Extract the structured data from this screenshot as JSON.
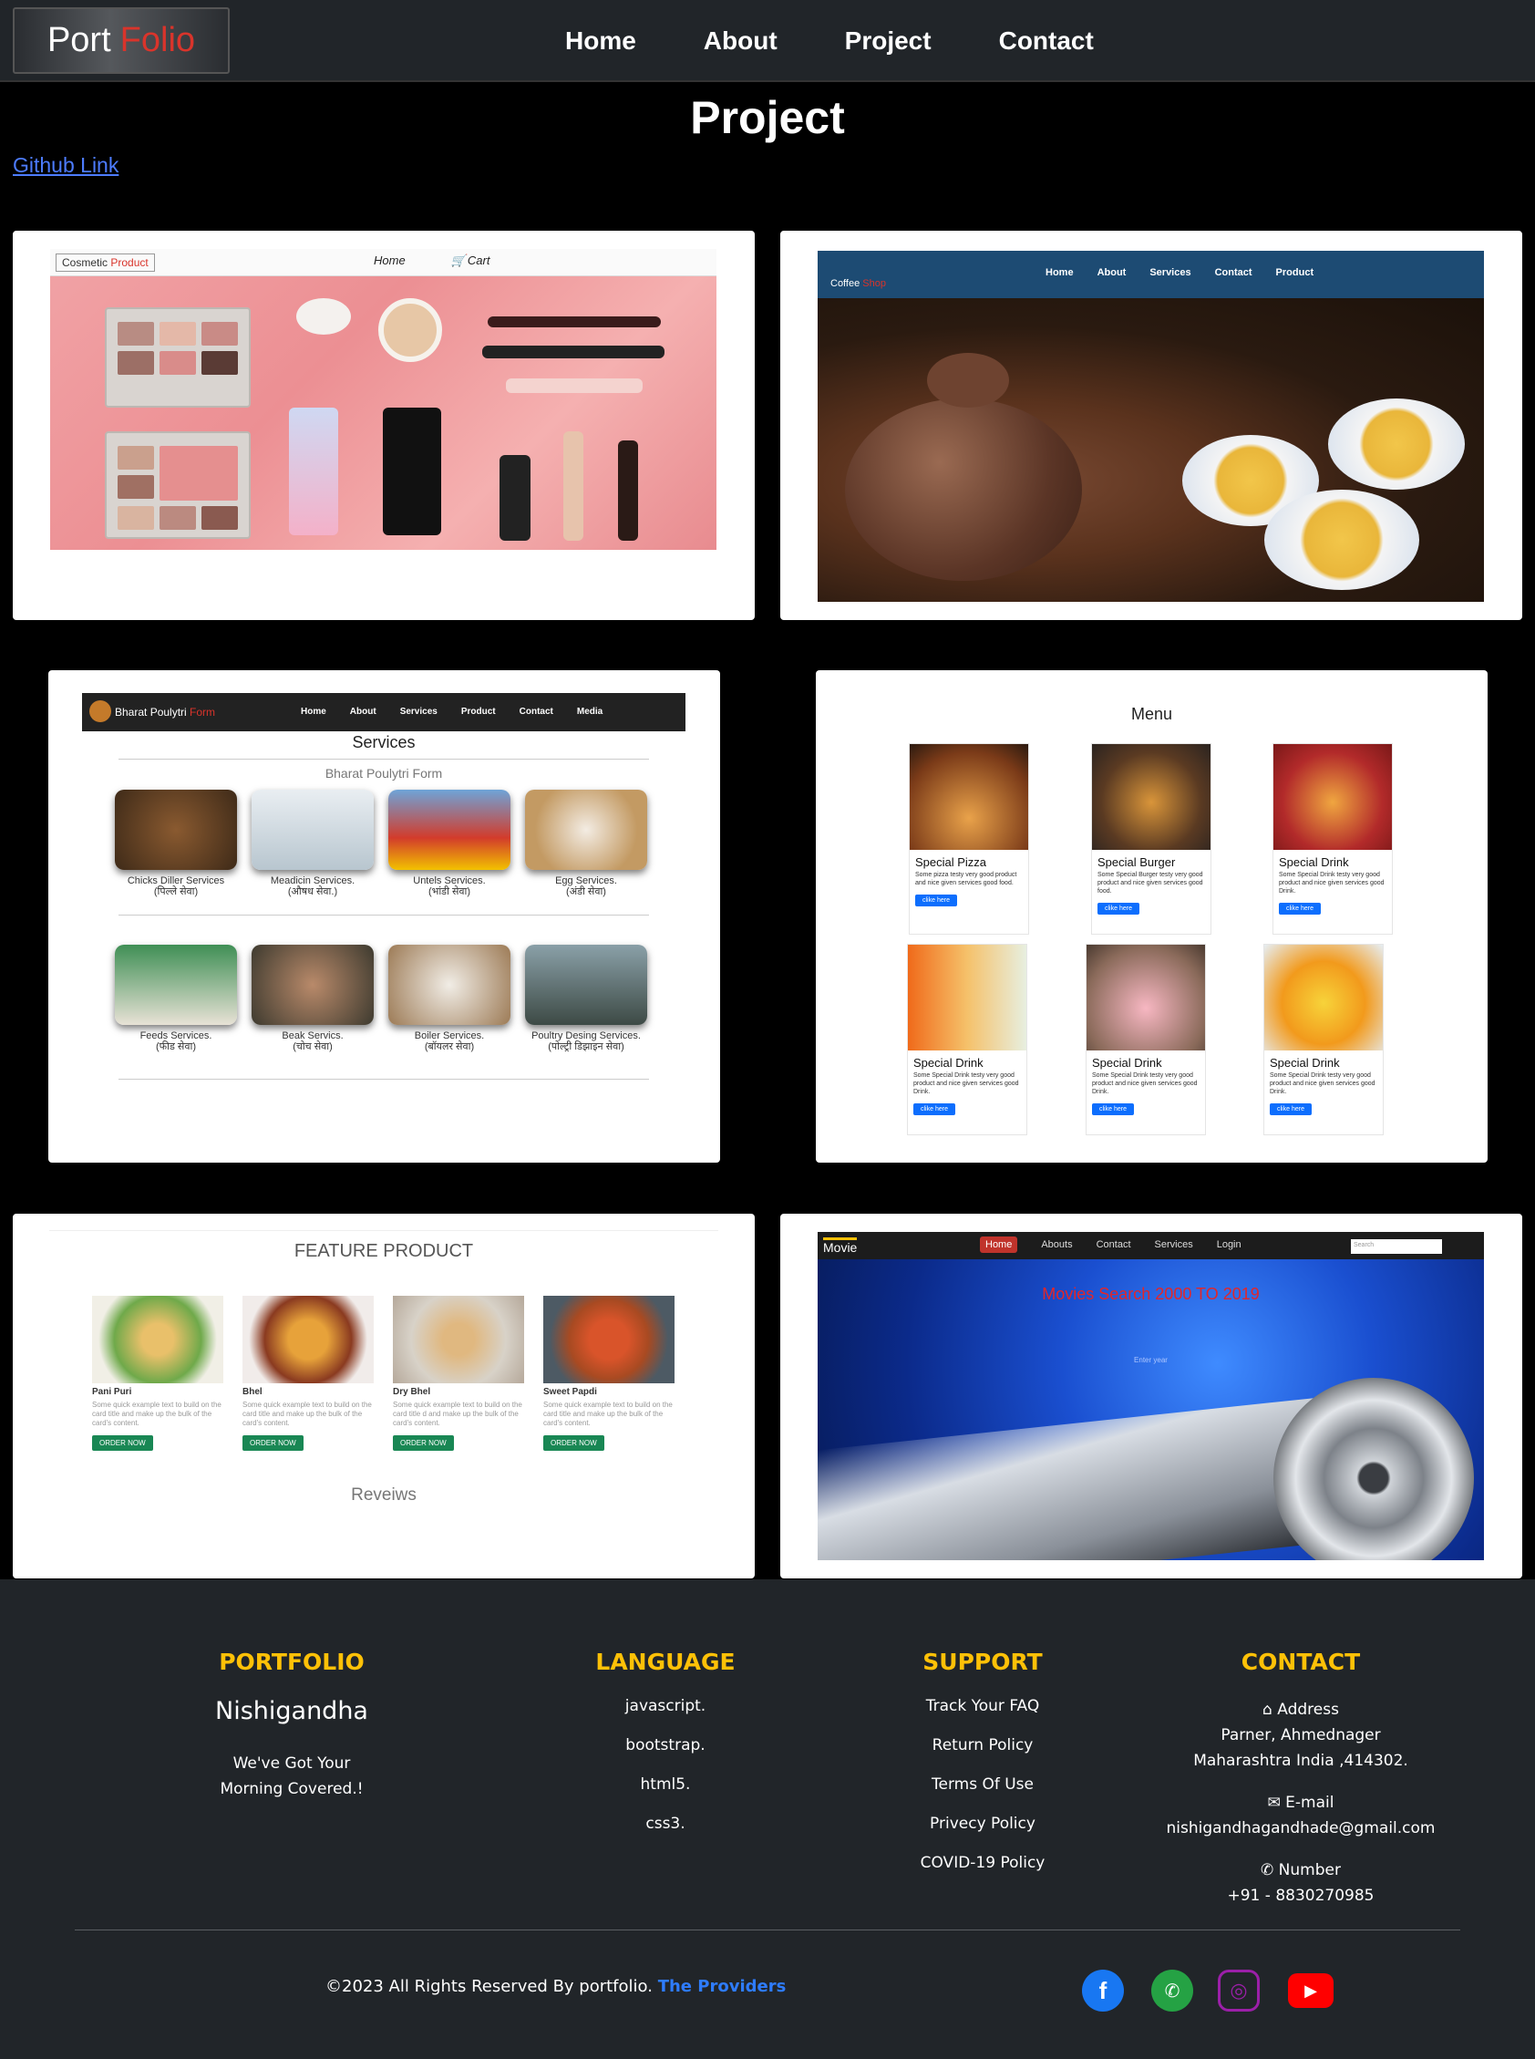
{
  "nav": {
    "brand_word1": "Port",
    "brand_word2": "Folio",
    "links": [
      "Home",
      "About",
      "Project",
      "Contact"
    ]
  },
  "page": {
    "title": "Project",
    "github_link": "Github Link"
  },
  "projects": {
    "cosmetic": {
      "brand_word1": "Cosmetic",
      "brand_word2": "Product",
      "links": [
        "Home",
        "Cart"
      ]
    },
    "coffee": {
      "brand_word1": "Coffee",
      "brand_word2": "Shop",
      "links": [
        "Home",
        "About",
        "Services",
        "Contact",
        "Product"
      ]
    },
    "poultry": {
      "brand_word1": "Bharat Poulytri",
      "brand_word2": "Form",
      "links": [
        "Home",
        "About",
        "Services",
        "Product",
        "Contact",
        "Media"
      ],
      "title": "Services",
      "subtitle": "Bharat Poulytri Form",
      "items": [
        {
          "label": "Chicks Diller Services",
          "sub": "(पिल्ले सेवा)"
        },
        {
          "label": "Meadicin Services.",
          "sub": "(औषध सेवा.)"
        },
        {
          "label": "Untels Services.",
          "sub": "(भांडी सेवा)"
        },
        {
          "label": "Egg Services.",
          "sub": "(अंडी सेवा)"
        },
        {
          "label": "Feeds Services.",
          "sub": "(फीड सेवा)"
        },
        {
          "label": "Beak Servics.",
          "sub": "(चोच सेवा)"
        },
        {
          "label": "Boiler Services.",
          "sub": "(बॉयलर सेवा)"
        },
        {
          "label": "Poultry Desing Services.",
          "sub": "(पोल्ट्री डिझाइन सेवा)"
        }
      ]
    },
    "menu": {
      "title": "Menu",
      "items": [
        {
          "name": "Special Pizza",
          "desc": "Some pizza testy very good product and nice given services good food.",
          "btn": "clike here"
        },
        {
          "name": "Special Burger",
          "desc": "Some Special Burger testy very good product and nice given services good food.",
          "btn": "clike here"
        },
        {
          "name": "Special Drink",
          "desc": "Some Special Drink testy very good product and nice given services good Drink.",
          "btn": "clike here"
        },
        {
          "name": "Special Drink",
          "desc": "Some Special Drink testy very good product and nice given services good Drink.",
          "btn": "clike here"
        },
        {
          "name": "Special Drink",
          "desc": "Some Special Drink testy very good product and nice given services good Drink.",
          "btn": "clike here"
        },
        {
          "name": "Special Drink",
          "desc": "Some Special Drink testy very good product and nice given services good Drink.",
          "btn": "clike here"
        }
      ]
    },
    "feature": {
      "title": "FEATURE PRODUCT",
      "reviews": "Reveiws",
      "items": [
        {
          "name": "Pani Puri",
          "desc": "Some quick example text to build on the card title and make up the bulk of the card's content.",
          "btn": "ORDER NOW"
        },
        {
          "name": "Bhel",
          "desc": "Some quick example text to build on the card title and make up the bulk of the card's content.",
          "btn": "ORDER NOW"
        },
        {
          "name": "Dry Bhel",
          "desc": "Some quick example text to build on the card title d and make up the bulk of the card's content.",
          "btn": "ORDER NOW"
        },
        {
          "name": "Sweet Papdi",
          "desc": "Some quick example text to build on the card title and make up the bulk of the card's content.",
          "btn": "ORDER NOW"
        }
      ]
    },
    "movie": {
      "brand": "Movie",
      "links": [
        "Home",
        "Abouts",
        "Contact",
        "Services",
        "Login"
      ],
      "search_placeholder": "Search",
      "title": "Movies Search 2000 TO 2019",
      "enter": "Enter year"
    }
  },
  "footer": {
    "portfolio": {
      "heading": "PORTFOLIO",
      "name": "Nishigandha",
      "tag_line1": "We've Got Your",
      "tag_line2": "Morning Covered.!"
    },
    "language": {
      "heading": "LANGUAGE",
      "items": [
        "javascript.",
        "bootstrap.",
        "html5.",
        "css3."
      ]
    },
    "support": {
      "heading": "SUPPORT",
      "items": [
        "Track Your FAQ",
        "Return Policy",
        "Terms Of Use",
        "Privecy Policy",
        "COVID-19 Policy"
      ]
    },
    "contact": {
      "heading": "CONTACT",
      "address_label": "Address",
      "address_line1": "Parner, Ahmednager",
      "address_line2": "Maharashtra India ,414302.",
      "email_label": "E-mail",
      "email": "nishigandhagandhade@gmail.com",
      "number_label": "Number",
      "number": "+91 - 8830270985"
    },
    "copyright": "©2023 All Rights Reserved By portfolio.",
    "providers": "The Providers",
    "social": [
      "facebook-icon",
      "whatsapp-icon",
      "instagram-icon",
      "youtube-icon"
    ]
  }
}
